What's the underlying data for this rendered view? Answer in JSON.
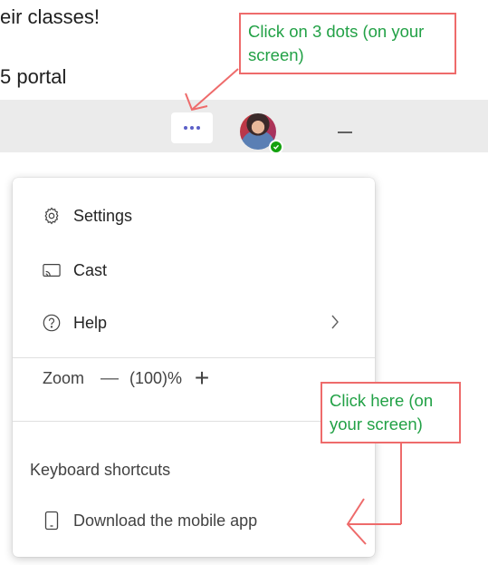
{
  "document": {
    "line_1": "eir classes!",
    "line_2": "5 portal"
  },
  "titlebar": {
    "more_button_icon": "more-horizontal-icon",
    "avatar_status": "available"
  },
  "menu": {
    "items": [
      {
        "label": "Settings",
        "icon": "gear-icon"
      },
      {
        "label": "Cast",
        "icon": "cast-icon"
      },
      {
        "label": "Help",
        "icon": "help-circle-icon"
      }
    ],
    "zoom": {
      "label": "Zoom",
      "minus": "—",
      "value": "(100)%",
      "plus": "+"
    },
    "keyboard_shortcuts": "Keyboard shortcuts",
    "download_app": "Download the mobile app"
  },
  "annotations": {
    "dots_callout": "Click on 3 dots (on your screen)",
    "here_callout": "Click here (on your screen)"
  },
  "colors": {
    "callout_border": "#ee6b6b",
    "callout_text": "#22a146",
    "presence": "#13a10e",
    "titlebar": "#ebebeb"
  }
}
